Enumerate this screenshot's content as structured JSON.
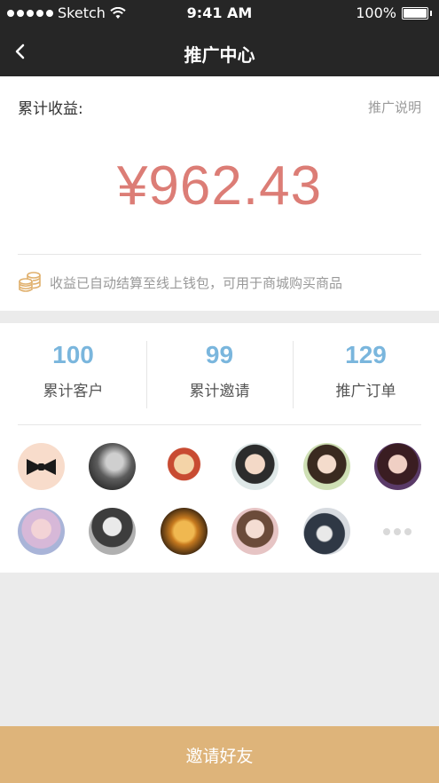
{
  "status_bar": {
    "carrier": "Sketch",
    "time": "9:41 AM",
    "battery": "100%",
    "battery_level": 1.0
  },
  "nav": {
    "title": "推广中心",
    "back_icon": "chevron-left-icon"
  },
  "earnings": {
    "label": "累计收益:",
    "help_link": "推广说明",
    "amount": "¥962.43",
    "note": "收益已自动结算至线上钱包，可用于商城购买商品",
    "note_icon": "coins-icon"
  },
  "stats": [
    {
      "value": "100",
      "label": "累计客户"
    },
    {
      "value": "99",
      "label": "累计邀请"
    },
    {
      "value": "129",
      "label": "推广订单"
    }
  ],
  "avatars": {
    "count_shown": 11,
    "more_icon": "more-dots-icon"
  },
  "invite_button": {
    "label": "邀请好友"
  },
  "colors": {
    "header_bg": "#262626",
    "amount": "#dc7d76",
    "stat_value": "#7ab6dd",
    "coin_icon": "#e0b06d",
    "button_bg": "#deb47a",
    "page_bg": "#ebebeb"
  }
}
